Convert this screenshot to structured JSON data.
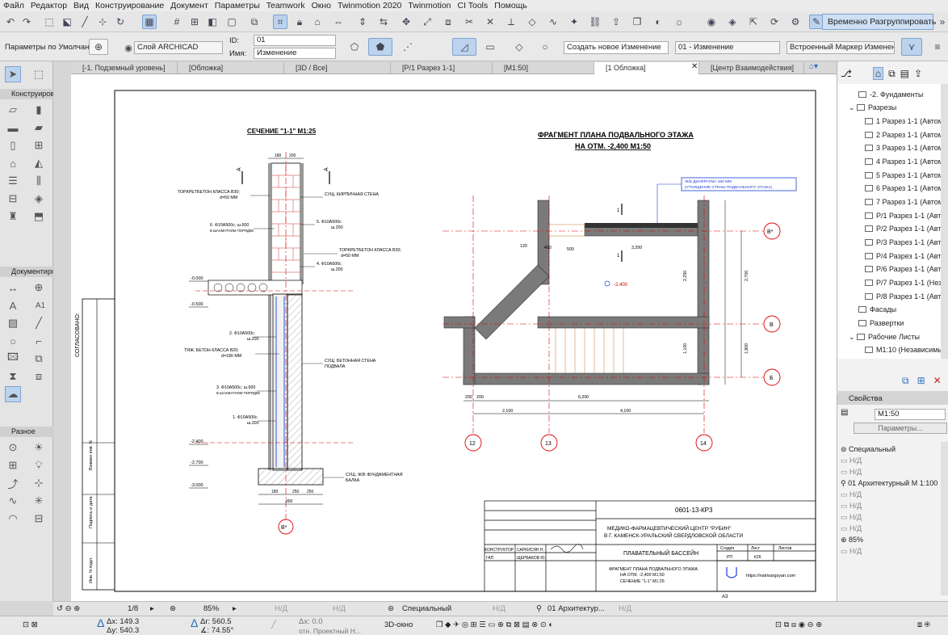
{
  "menu": [
    "Файл",
    "Редактор",
    "Вид",
    "Конструирование",
    "Документ",
    "Параметры",
    "Teamwork",
    "Окно",
    "Twinmotion 2020",
    "Twinmotion",
    "CI Tools",
    "Помощь"
  ],
  "toolbar": {
    "ungroup_label": "Временно Разгруппировать"
  },
  "infobox": {
    "default_params": "Параметры по Умолчанию",
    "layer": "Слой ARCHICAD",
    "id_label": "ID:",
    "id_value": "01",
    "name_label": "Имя:",
    "name_value": "Изменение",
    "create_change": "Создать новое Изменение",
    "change_value": "01 - Изменение",
    "marker": "Встроенный Маркер Изменения"
  },
  "tabs": [
    "[-1. Подземный уровень]",
    "[Обложка]",
    "[3D / Все]",
    "[P/1 Разрез 1-1]",
    "[M1:50]",
    "[1 Обложка]",
    "[Центр Взаимодействия]"
  ],
  "toolbox": {
    "section1": "Конструирова",
    "section2": "Документиро",
    "section3": "Разное",
    "label_a1": "A1"
  },
  "navigator": {
    "items": [
      "-2. Фундаменты",
      "Разрезы",
      "1 Разрез 1-1 (Автома",
      "2 Разрез 1-1 (Автома",
      "3 Разрез 1-1 (Автома",
      "4 Разрез 1-1 (Автома",
      "5 Разрез 1-1 (Автома",
      "6 Разрез 1-1 (Автома",
      "7 Разрез 1-1 (Автома",
      "P/1 Разрез 1-1 (Автом",
      "P/2 Разрез 1-1 (Автом",
      "P/3 Разрез 1-1 (Автом",
      "P/4 Разрез 1-1 (Автом",
      "P/6 Разрез 1-1 (Автом",
      "P/7 Разрез 1-1 (Незав",
      "P/8 Разрез 1-1 (Автом",
      "Фасады",
      "Развертки",
      "Рабочие Листы",
      "M1:10 (Независимый)"
    ]
  },
  "properties": {
    "title": "Свойства",
    "field": "M1:50",
    "params_button": "Параметры...",
    "rows": [
      "Специальный",
      "Н/Д",
      "Н/Д",
      "01 Архитектурный М 1:100",
      "Н/Д",
      "Н/Д",
      "Н/Д",
      "Н/Д",
      "85%",
      "Н/Д"
    ]
  },
  "status": {
    "page": "1/8",
    "zoom": "85%",
    "nd1": "Н/Д",
    "nd2": "Н/Д",
    "layer_combo": "Специальный",
    "nd3": "Н/Д",
    "nd4": "Н/Д",
    "arch": "01 Архитектур...",
    "dx": "Δx: 149.3",
    "dy": "Δy: 540.3",
    "dr": "Δr: 560.5",
    "angle": "∡: 74.55°",
    "zx": "Δx: 0.0",
    "ref": "отн. Проектный Н...",
    "view3d": "3D-окно"
  },
  "drawing": {
    "section_title": "СЕЧЕНИЕ \"1-1\"  М1:25",
    "plan_title_1": "ФРАГМЕНТ ПЛАНА ПОДВАЛЬНОГО ЭТАЖА",
    "plan_title_2": "НА ОТМ.  -2,400  М1:50",
    "diaphragm_1": "Ж/Б ДИАФРАГМА 180 ММ",
    "diaphragm_2": "(УТОЛЩЕНИЕ СТЕНЫ ПОДВАЛЬНОГО ЭТАЖА)",
    "labels_left": [
      "ТОРКРЕТБЕТОН КЛАССА В30;",
      "d=50 ММ",
      "6. Ф10А500с; ш.600",
      "В ШАХМАТНОМ ПОРЯДКЕ",
      "2. Ф10А500с",
      "ш.200",
      "ТЯЖ. БЕТОН КЛАССА В20;",
      "d=180 ММ",
      "3. Ф10А500с; ш.600",
      "В ШАХМАТНОМ ПОРЯДКЕ",
      "1. Ф10А500с",
      "ш.200"
    ],
    "labels_right": [
      "СУЩ. КИРПИЧНАЯ СТЕНА",
      "5. Ф10А500с",
      "ш.200",
      "ТОРКРЕТБЕТОН КЛАССА В30;",
      "d=50 ММ",
      "4. Ф10А500с",
      "ш.200",
      "СУЩ. БЕТОННАЯ СТЕНА",
      "ПОДВАЛА",
      "СУЩ. Ж/Б ФУНДАМЕНТНАЯ",
      "БАЛКА"
    ],
    "levels": [
      "-0.000",
      "-0.500",
      "-2.400",
      "-2.700",
      "-3.000"
    ],
    "section_dims": [
      "180",
      "200",
      "180",
      "250",
      "250",
      "800"
    ],
    "section_axis": "В*",
    "plan_level": "-2.400",
    "plan_dims": [
      "3,200",
      "6,200",
      "2,100",
      "4,100",
      "2,250",
      "2,700",
      "1,100",
      "1,800",
      "500",
      "400",
      "120",
      "200",
      "200"
    ],
    "axes": [
      "12",
      "13",
      "14",
      "В*",
      "В",
      "Б"
    ],
    "section_marks": [
      "1",
      "1"
    ],
    "sheet_a3": "А3",
    "side_note": "СОГЛАСОВАНО:",
    "side_rows": [
      "Взамен инв. N",
      "Подпись и дата",
      "Инв. N подл."
    ],
    "stamp": {
      "code": "0601-13-КР3",
      "org_1": "МЕДИКО-ФАРМАЦЕВТИЧЕСКИЙ ЦЕНТР \"РУБИН\"",
      "org_2": "В Г. КАМЕНСК-УРАЛЬСКИЙ СВЕРДЛОВСКОЙ ОБЛАСТИ",
      "building": "ПЛАВАТЕЛЬНЫЙ БАССЕЙН",
      "sheet_1": "ФРАГМЕНТ ПЛАНА ПОДВАЛЬНОГО ЭТАЖА",
      "sheet_2": "НА ОТМ.  -2,400  М1:50",
      "sheet_3": "СЕЧЕНИЕ  \"1-1\"  М1:25",
      "role_1": "КОНСТРУКТОР",
      "name_1": "САРКИСЯН Н.",
      "role_2": "ГАП",
      "name_2": "ЩЕРБАКОВ Ю.",
      "stage_h": "Стадия",
      "sheet_h": "Лист",
      "sheets_h": "Листов",
      "stage": "РП",
      "sheet": "К26",
      "site": "https://nairisargsyan.com"
    }
  }
}
